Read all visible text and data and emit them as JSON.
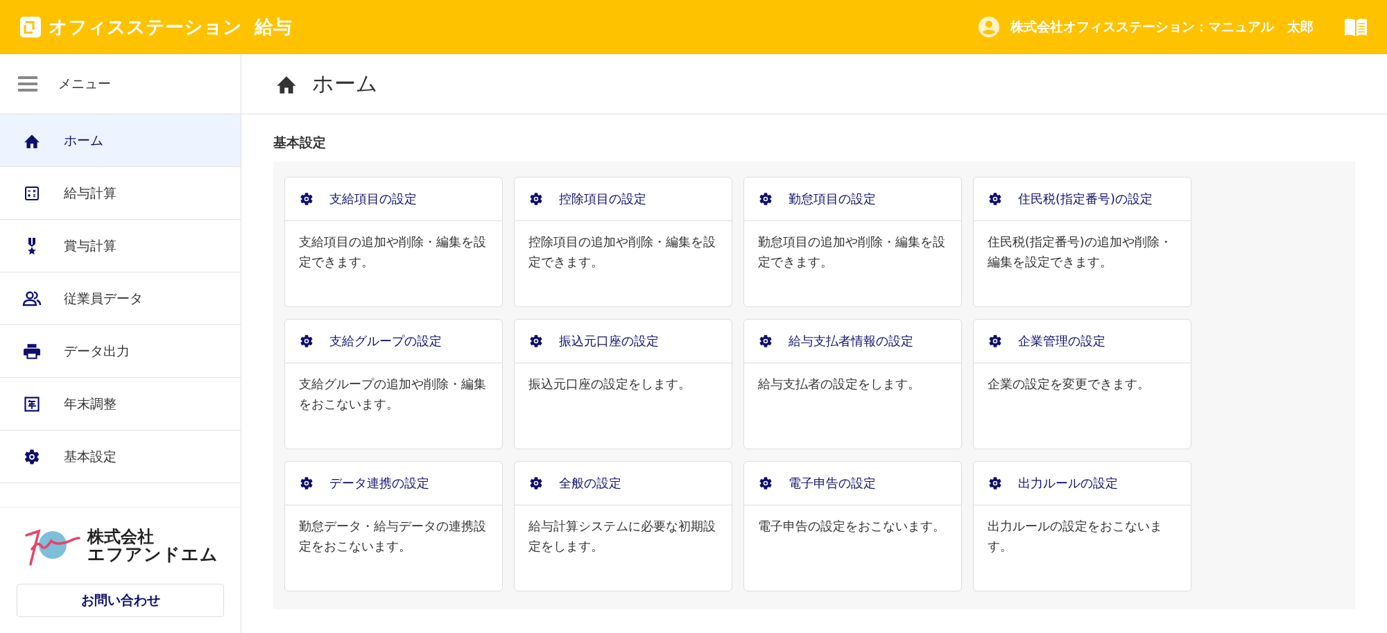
{
  "header": {
    "app_name": "オフィスステーション",
    "product": "給与",
    "user": "株式会社オフィスステーション：マニュアル　太郎"
  },
  "sidebar": {
    "menu_label": "メニュー",
    "items": [
      {
        "label": "ホーム",
        "selected": true
      },
      {
        "label": "給与計算",
        "selected": false
      },
      {
        "label": "賞与計算",
        "selected": false
      },
      {
        "label": "従業員データ",
        "selected": false
      },
      {
        "label": "データ出力",
        "selected": false
      },
      {
        "label": "年末調整",
        "selected": false
      },
      {
        "label": "基本設定",
        "selected": false
      }
    ],
    "company_logo": {
      "line_1": "株式会社",
      "line_2": "エフアンドエム"
    },
    "contact_button": "お問い合わせ"
  },
  "page": {
    "title": "ホーム",
    "section_title": "基本設定",
    "cards": [
      {
        "title": "支給項目の設定",
        "description": "支給項目の追加や削除・編集を設定できます。"
      },
      {
        "title": "控除項目の設定",
        "description": "控除項目の追加や削除・編集を設定できます。"
      },
      {
        "title": "勤怠項目の設定",
        "description": "勤怠項目の追加や削除・編集を設定できます。"
      },
      {
        "title": "住民税(指定番号)の設定",
        "description": "住民税(指定番号)の追加や削除・編集を設定できます。"
      },
      {
        "title": "支給グループの設定",
        "description": "支給グループの追加や削除・編集をおこないます。"
      },
      {
        "title": "振込元口座の設定",
        "description": "振込元口座の設定をします。"
      },
      {
        "title": "給与支払者情報の設定",
        "description": "給与支払者の設定をします。"
      },
      {
        "title": "企業管理の設定",
        "description": "企業の設定を変更できます。"
      },
      {
        "title": "データ連携の設定",
        "description": "勤怠データ・給与データの連携設定をおこないます。"
      },
      {
        "title": "全般の設定",
        "description": "給与計算システムに必要な初期設定をします。"
      },
      {
        "title": "電子申告の設定",
        "description": "電子申告の設定をおこないます。"
      },
      {
        "title": "出力ルールの設定",
        "description": "出力ルールの設定をおこないます。"
      }
    ]
  }
}
